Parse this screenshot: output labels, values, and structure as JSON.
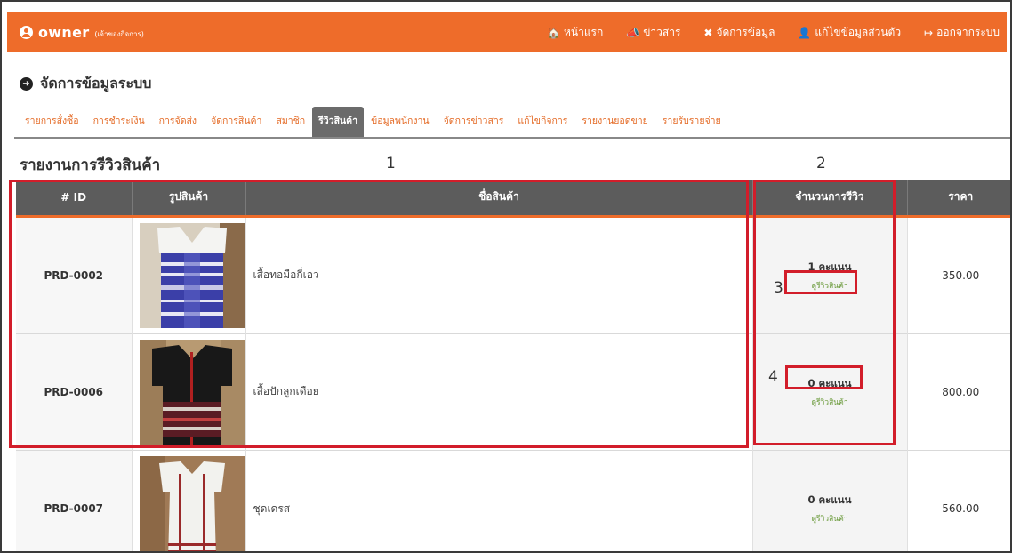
{
  "topbar": {
    "brand": "owner",
    "brand_sub": "(เจ้าของกิจการ)",
    "nav": [
      {
        "icon": "home-icon",
        "glyph": "🏠",
        "label": "หน้าแรก"
      },
      {
        "icon": "megaphone-icon",
        "glyph": "📣",
        "label": "ข่าวสาร"
      },
      {
        "icon": "tools-icon",
        "glyph": "✖",
        "label": "จัดการข้อมูล"
      },
      {
        "icon": "user-edit-icon",
        "glyph": "👤",
        "label": "แก้ไขข้อมูลส่วนตัว"
      },
      {
        "icon": "logout-icon",
        "glyph": "↦",
        "label": "ออกจากระบบ"
      }
    ]
  },
  "system_title": "จัดการข้อมูลระบบ",
  "tabs": [
    {
      "label": "รายการสั่งซื้อ",
      "active": false
    },
    {
      "label": "การชำระเงิน",
      "active": false
    },
    {
      "label": "การจัดส่ง",
      "active": false
    },
    {
      "label": "จัดการสินค้า",
      "active": false
    },
    {
      "label": "สมาชิก",
      "active": false
    },
    {
      "label": "รีวิวสินค้า",
      "active": true
    },
    {
      "label": "ข้อมูลพนักงาน",
      "active": false
    },
    {
      "label": "จัดการข่าวสาร",
      "active": false
    },
    {
      "label": "แก้ไขกิจการ",
      "active": false
    },
    {
      "label": "รายงานยอดขาย",
      "active": false
    },
    {
      "label": "รายรับรายจ่าย",
      "active": false
    }
  ],
  "report": {
    "title": "รายงานการรีวิวสินค้า",
    "columns": [
      "# ID",
      "รูปสินค้า",
      "ชื่อสินค้า",
      "จำนวนการรีวิว",
      "ราคา"
    ],
    "rows": [
      {
        "id": "PRD-0002",
        "name": "เสื้อทอมือกี่เอว",
        "score": "1 คะแนน",
        "link": "ดูรีวิวสินค้า",
        "price": "350.00"
      },
      {
        "id": "PRD-0006",
        "name": "เสื้อปักลูกเดือย",
        "score": "0 คะแนน",
        "link": "ดูรีวิวสินค้า",
        "price": "800.00"
      },
      {
        "id": "PRD-0007",
        "name": "ชุดเดรส",
        "score": "0 คะแนน",
        "link": "ดูรีวิวสินค้า",
        "price": "560.00"
      }
    ]
  },
  "annotations": [
    "1",
    "2",
    "3",
    "4"
  ],
  "colors": {
    "accent": "#ee6c2a",
    "header": "#5c5c5c",
    "annotation": "#d21d2a",
    "link": "#6a9a3a"
  }
}
